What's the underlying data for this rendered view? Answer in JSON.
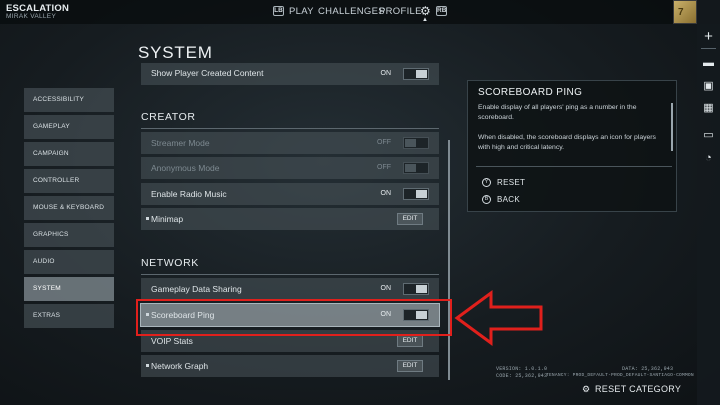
{
  "top": {
    "game_title": "ESCALATION",
    "game_subtitle": "MIRAK VALLEY",
    "left_key": "LB",
    "right_key": "RB",
    "nav": [
      "PLAY",
      "CHALLENGES",
      "PROFILE"
    ],
    "emblem_number": "7"
  },
  "page_title": "SYSTEM",
  "categories": [
    {
      "label": "ACCESSIBILITY"
    },
    {
      "label": "GAMEPLAY"
    },
    {
      "label": "CAMPAIGN"
    },
    {
      "label": "CONTROLLER"
    },
    {
      "label": "MOUSE & KEYBOARD"
    },
    {
      "label": "GRAPHICS"
    },
    {
      "label": "AUDIO"
    },
    {
      "label": "SYSTEM",
      "active": true
    },
    {
      "label": "EXTRAS"
    }
  ],
  "settings": {
    "show_player_content": {
      "label": "Show Player Created Content",
      "value": "ON"
    },
    "creator_header": "CREATOR",
    "streamer_mode": {
      "label": "Streamer Mode",
      "value": "OFF"
    },
    "anonymous_mode": {
      "label": "Anonymous Mode",
      "value": "OFF"
    },
    "radio_music": {
      "label": "Enable Radio Music",
      "value": "ON"
    },
    "minimap": {
      "label": "Minimap",
      "button": "EDIT"
    },
    "network_header": "NETWORK",
    "data_sharing": {
      "label": "Gameplay Data Sharing",
      "value": "ON"
    },
    "scoreboard_ping": {
      "label": "Scoreboard Ping",
      "value": "ON"
    },
    "voip_stats": {
      "label": "VOIP Stats",
      "button": "EDIT"
    },
    "network_graph": {
      "label": "Network Graph",
      "button": "EDIT"
    }
  },
  "info_panel": {
    "title": "SCOREBOARD PING",
    "paragraph1": "Enable display of all players' ping as a number in the scoreboard.",
    "paragraph2": "When disabled, the scoreboard displays an icon for players with high and critical latency.",
    "reset_label": "RESET",
    "back_label": "BACK",
    "reset_key": "Y",
    "back_key": "B"
  },
  "footer": {
    "version": "VERSION: 1.0.1.0",
    "code": "CODE: 25,362,943",
    "data": "DATA: 25,362,943",
    "tenancy": "TENANCY: PROD_DEFAULT-PROD_DEFAULT-SANTIAGO-COMMON",
    "reset_category": "RESET CATEGORY"
  },
  "colors": {
    "annotation": "#e0201c",
    "panel": "#0e1214",
    "row": "#485258"
  }
}
